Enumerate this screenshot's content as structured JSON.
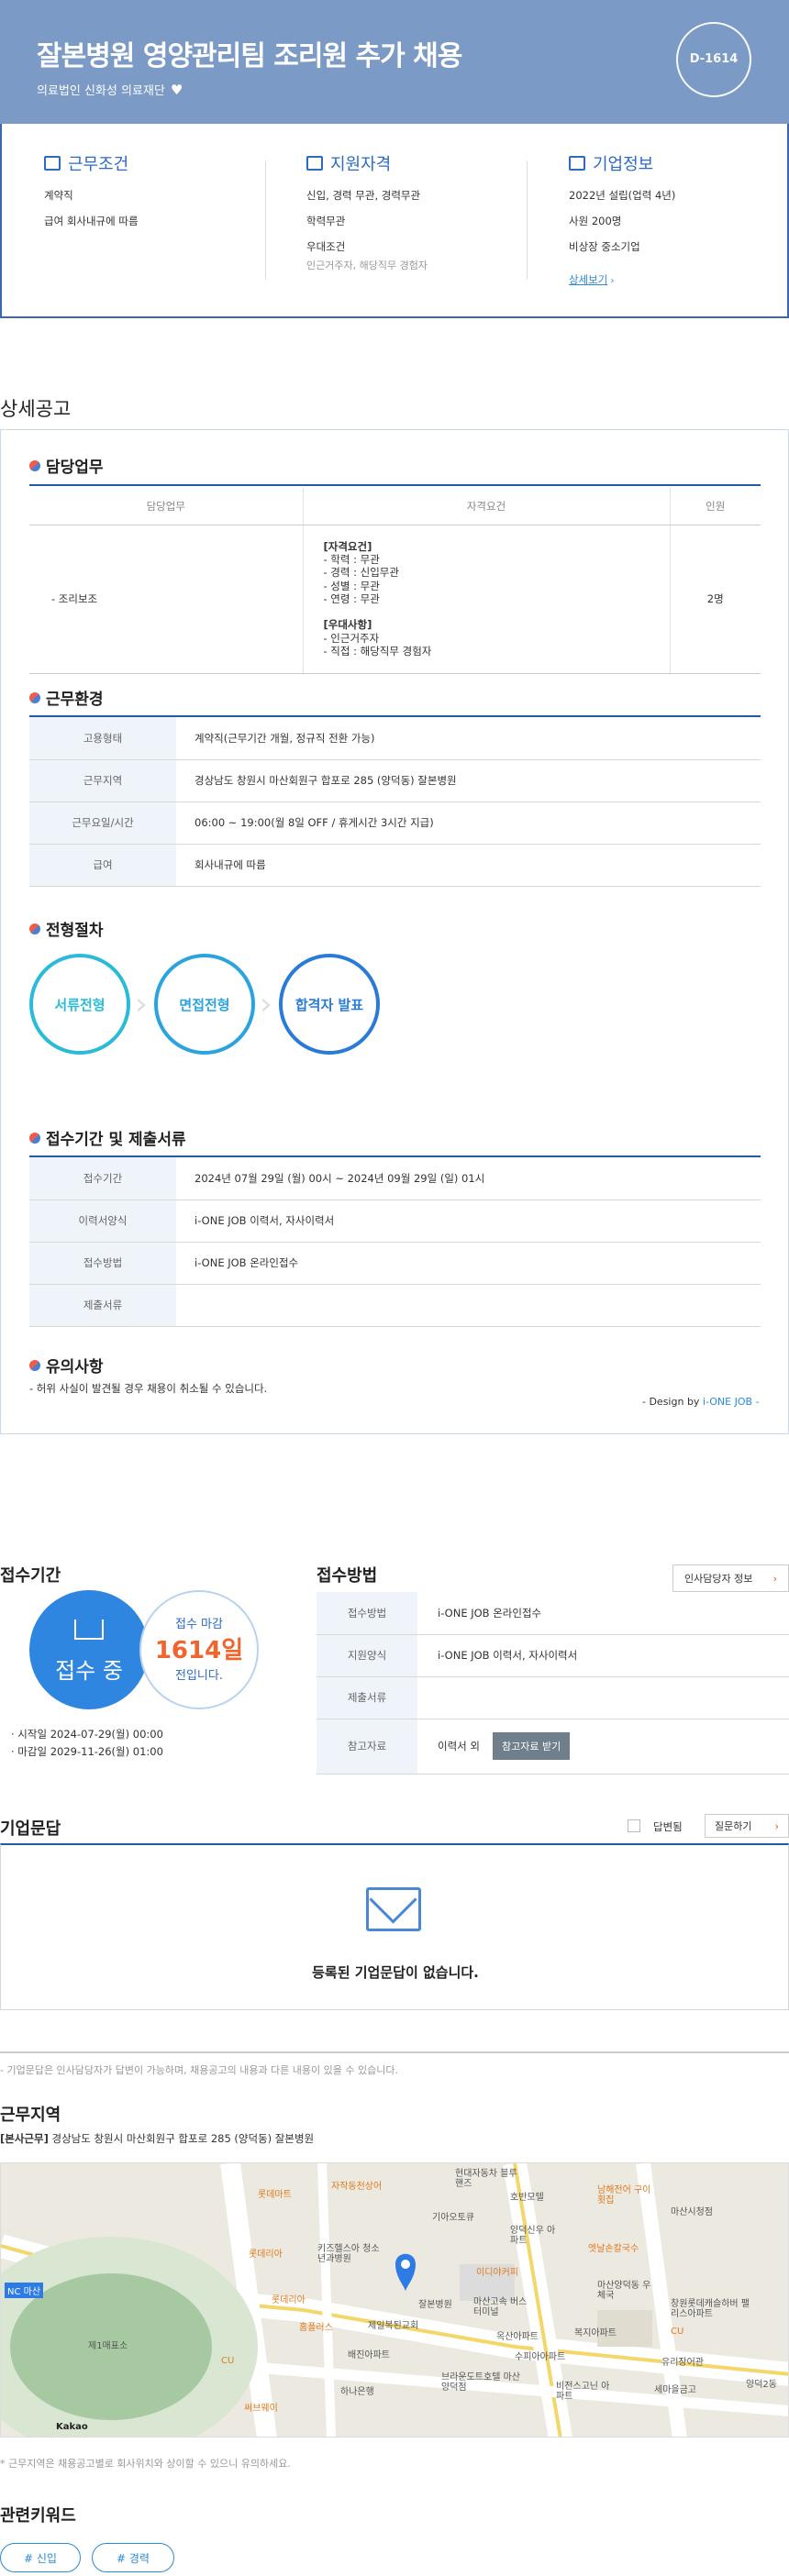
{
  "header": {
    "title": "잘본병원 영양관리팀 조리원 추가 채용",
    "company": "의료법인 신화성 의료재단",
    "dday": "D-1614"
  },
  "summary": {
    "work": {
      "title": "근무조건",
      "rows": [
        "계약직",
        "급여 회사내규에 따름"
      ]
    },
    "qual": {
      "title": "지원자격",
      "rows": [
        "신입, 경력 무관, 경력무관",
        "학력무관",
        "우대조건"
      ],
      "sub": "인근거주자, 해당직무 경험자"
    },
    "corp": {
      "title": "기업정보",
      "rows": [
        "2022년 설립(업력 4년)",
        "사원 200명",
        "비상장 중소기업"
      ],
      "link": "상세보기"
    }
  },
  "detail": {
    "section_title": "상세공고",
    "duty": {
      "title": "담당업무",
      "headers": [
        "담당업무",
        "자격요건",
        "인원"
      ],
      "task": "- 조리보조",
      "req_head": "[자격요건]",
      "req_lines": [
        "- 학력 : 무관",
        "- 경력 : 신입무관",
        "- 성별 : 무관",
        "- 연령 : 무관"
      ],
      "pref_head": "[우대사항]",
      "pref_lines": [
        "- 인근거주자",
        "- 직접 : 해당직무 경험자"
      ],
      "count": "2명"
    },
    "env": {
      "title": "근무환경",
      "rows": [
        {
          "k": "고용형태",
          "v": "계약직(근무기간 개월, 정규직 전환 가능)"
        },
        {
          "k": "근무지역",
          "v": "경상남도 창원시 마산회원구 합포로 285 (양덕동) 잘본병원"
        },
        {
          "k": "근무요일/시간",
          "v": "06:00 ~ 19:00(월 8일 OFF / 휴게시간 3시간 지급)"
        },
        {
          "k": "급여",
          "v": "회사내규에 따름"
        }
      ]
    },
    "process": {
      "title": "전형절차",
      "steps": [
        "서류전형",
        "면접전형",
        "합격자 발표"
      ]
    },
    "docs": {
      "title": "접수기간 및 제출서류",
      "rows": [
        {
          "k": "접수기간",
          "v": "2024년 07월 29일 (월) 00시 ~ 2024년 09월 29일 (일) 01시"
        },
        {
          "k": "이력서양식",
          "v": "i-ONE JOB 이력서, 자사이력서"
        },
        {
          "k": "접수방법",
          "v": "i-ONE JOB 온라인접수"
        },
        {
          "k": "제출서류",
          "v": ""
        }
      ]
    },
    "notice": {
      "title": "유의사항",
      "text": "- 허위 사실이 발견될 경우 채용이 취소될 수 있습니다.",
      "design_prefix": "- Design by ",
      "design_brand": "i-ONE JOB",
      "design_suffix": " -"
    }
  },
  "period": {
    "title": "접수기간",
    "status": "접수 중",
    "deadline_label": "접수 마감",
    "deadline_days": "1614일",
    "deadline_suffix": "전입니다.",
    "start": "· 시작일 2024-07-29(월) 00:00",
    "end": "· 마감일 2029-11-26(월) 01:00"
  },
  "receive": {
    "title": "접수방법",
    "hr_button": "인사담당자 정보",
    "rows": [
      {
        "k": "접수방법",
        "v": "i-ONE JOB 온라인접수"
      },
      {
        "k": "지원양식",
        "v": "i-ONE JOB 이력서, 자사이력서"
      },
      {
        "k": "제출서류",
        "v": ""
      },
      {
        "k": "참고자료",
        "v": "이력서 외"
      }
    ],
    "ref_button": "참고자료 받기"
  },
  "qa": {
    "title": "기업문답",
    "answered_label": "답변됨",
    "ask_button": "질문하기",
    "empty": "등록된 기업문답이 없습니다.",
    "note": "- 기업문답은 인사담당자가 답변이 가능하며, 채용공고의 내용과 다른 내용이 있을 수 있습니다."
  },
  "location": {
    "title": "근무지역",
    "addr_label": "[본사근무]",
    "addr": " 경상남도 창원시 마산회원구 합포로 285 (양덕동) 잘본병원",
    "note": "* 근무지역은 채용공고별로 회사위치와 상이할 수 있으니 유의하세요.",
    "map_labels": [
      "롯데마트",
      "자작동천상어",
      "현대자동차 블루핸즈",
      "호반모텔",
      "남해전어 구이횟집",
      "마산시청점",
      "키즈헬스아 청소년과병원",
      "기아오토큐",
      "양덕신우 아파트",
      "엣날손칼국수",
      "롯데리아",
      "이디야커피",
      "잘본병원",
      "마산고속 버스터미널",
      "마산양덕동 우체국",
      "창원롯데캐슬하버 팰리스아파트",
      "롯데리아",
      "홈플러스",
      "제일복된교회",
      "옥산아파트",
      "복지아파트",
      "배진아파트",
      "수피아아파트",
      "CU",
      "유리장어관",
      "세마을금고",
      "하나은행",
      "브라운도트호텔 마산양덕점",
      "비전스고닌 아파트",
      "NC 마산",
      "제1매표소",
      "써브웨이",
      "CU",
      "양덕2동"
    ],
    "map_brand": "Kakao"
  },
  "keywords": {
    "title": "관련키워드",
    "items": [
      "# 신입",
      "# 경력"
    ]
  },
  "colors": {
    "accent": "#2b6bc5",
    "hero": "#7b9ac5",
    "deadline": "#f0642e"
  }
}
